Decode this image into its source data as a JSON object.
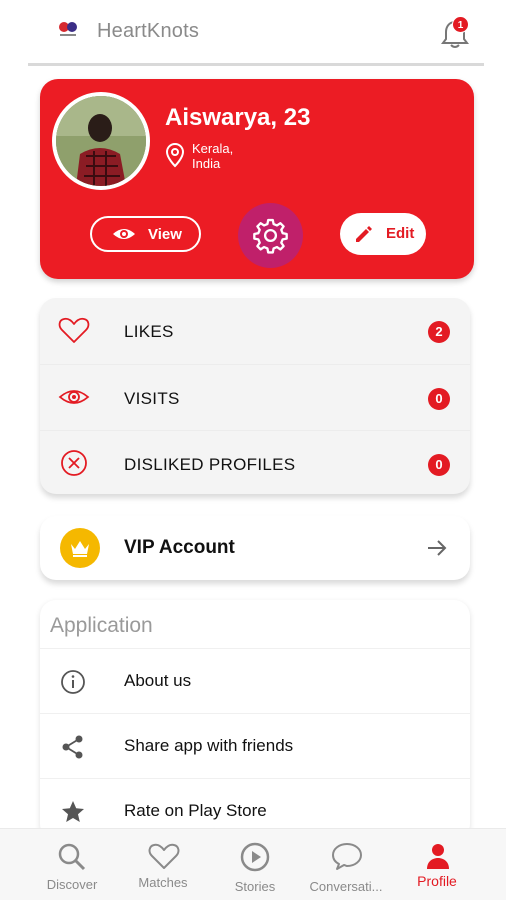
{
  "header": {
    "app_title": "HeartKnots",
    "notification_count": "1"
  },
  "profile": {
    "name": "Aiswarya, 23",
    "location": "Kerala, India",
    "view_label": "View",
    "edit_label": "Edit"
  },
  "stats": [
    {
      "label": "LIKES",
      "count": "2",
      "icon": "heart-icon"
    },
    {
      "label": "VISITS",
      "count": "0",
      "icon": "eye-icon"
    },
    {
      "label": "DISLIKED PROFILES",
      "count": "0",
      "icon": "x-circle-icon"
    }
  ],
  "vip": {
    "label": "VIP Account",
    "icon": "crown-icon"
  },
  "application": {
    "heading": "Application",
    "items": [
      {
        "label": "About us",
        "icon": "info-icon"
      },
      {
        "label": "Share app with friends",
        "icon": "share-icon"
      },
      {
        "label": "Rate on Play Store",
        "icon": "star-icon"
      }
    ]
  },
  "nav": {
    "items": [
      {
        "label": "Discover",
        "icon": "search-icon"
      },
      {
        "label": "Matches",
        "icon": "heart-icon"
      },
      {
        "label": "Stories",
        "icon": "play-circle-icon"
      },
      {
        "label": "Conversati...",
        "icon": "chat-icon"
      },
      {
        "label": "Profile",
        "icon": "person-icon"
      }
    ],
    "active": "Profile"
  },
  "colors": {
    "accent": "#ec1c24",
    "settings_bg": "#c0206a",
    "vip_gold": "#f5b800",
    "muted": "#8a8a8a"
  }
}
